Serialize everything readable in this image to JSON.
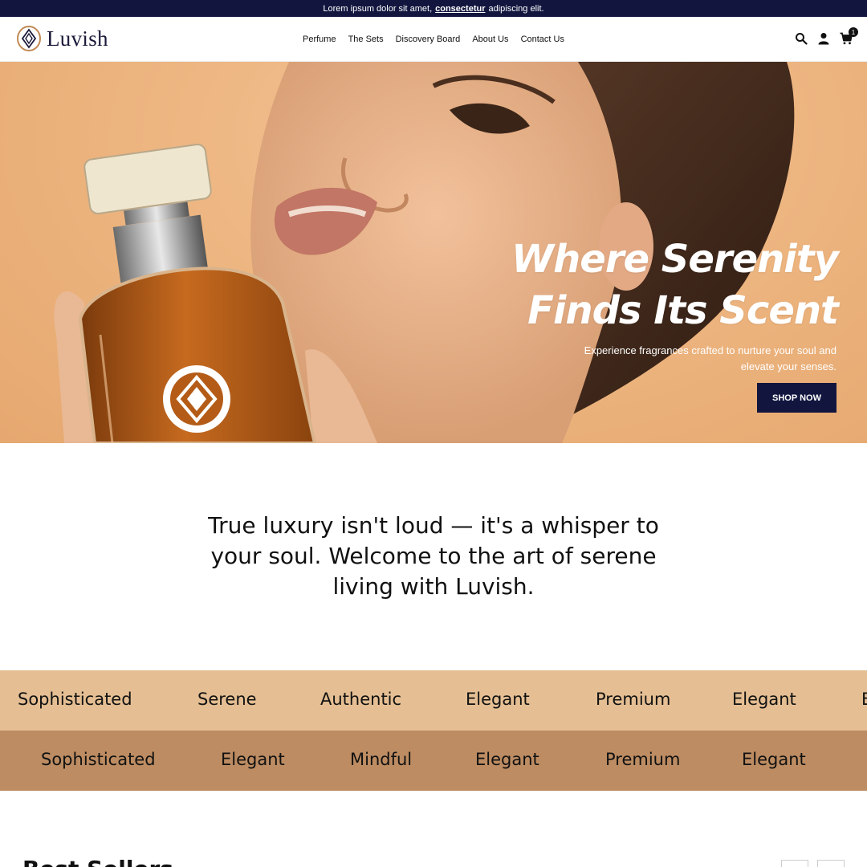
{
  "announcement": {
    "text_before": "Lorem ipsum dolor sit amet,",
    "strong": "consectetur",
    "text_after": "adipiscing elit."
  },
  "header": {
    "logo_text": "Luvish",
    "nav": [
      "Perfume",
      "The Sets",
      "Discovery Board",
      "About Us",
      "Contact Us"
    ],
    "icons": [
      "search-icon",
      "user-icon",
      "cart-icon"
    ],
    "cart_count": "1"
  },
  "hero": {
    "title_line1": "Where Serenity",
    "title_line2": "Finds Its Scent",
    "subtitle_line1": "Experience fragrances crafted to nurture your soul and",
    "subtitle_line2": "elevate your senses.",
    "cta": "SHOP NOW"
  },
  "statement": {
    "line1": "True luxury isn't loud — it's a whisper to",
    "line2": "your soul. Welcome to the art of serene",
    "line3": "living with Luvish."
  },
  "marquee": {
    "row1": [
      "Sophisticated",
      "Serene",
      "Authentic",
      "Elegant",
      "Premium",
      "Elegant",
      "E"
    ],
    "row2": [
      "Sophisticated",
      "Elegant",
      "Mindful",
      "Elegant",
      "Premium",
      "Elegant"
    ]
  },
  "best_sellers": {
    "title": "Best Sellers"
  },
  "colors": {
    "navy": "#12163f",
    "band_light": "#e5bf93",
    "band_dark": "#bd8c62",
    "hero_bg": "#eeb783"
  }
}
